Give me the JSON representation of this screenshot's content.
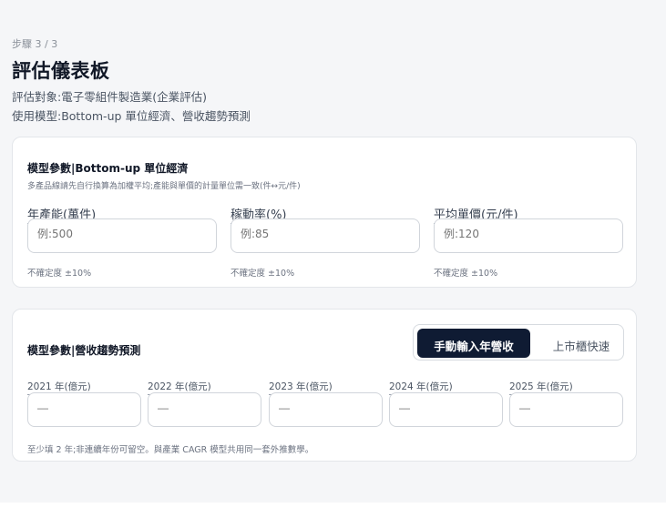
{
  "header": {
    "step": "步驟 3 / 3",
    "title": "評估儀表板",
    "subject": "評估對象:電子零組件製造業(企業評估)",
    "model": "使用模型:Bottom-up 單位經濟、營收趨勢預測"
  },
  "unit_economics": {
    "title": "模型參數|Bottom-up 單位經濟",
    "note": "多產品線請先自行換算為加權平均;產能與單價的計量單位需一致(件↔元/件)",
    "fields": [
      {
        "label": "年產能(萬件)",
        "placeholder": "例:500",
        "hint": "不確定度 ±10%"
      },
      {
        "label": "稼動率(%)",
        "placeholder": "例:85",
        "hint": "不確定度 ±10%"
      },
      {
        "label": "平均單價(元/件)",
        "placeholder": "例:120",
        "hint": "不確定度 ±10%"
      }
    ]
  },
  "revenue_trend": {
    "title": "模型參數|營收趨勢預測",
    "toggle": {
      "active": "手動輸入年營收",
      "inactive": "上市櫃快速"
    },
    "years": [
      {
        "label": "2021 年(億元)",
        "placeholder": "—"
      },
      {
        "label": "2022 年(億元)",
        "placeholder": "—"
      },
      {
        "label": "2023 年(億元)",
        "placeholder": "—"
      },
      {
        "label": "2024 年(億元)",
        "placeholder": "—"
      },
      {
        "label": "2025 年(億元)",
        "placeholder": "—"
      }
    ],
    "footnote": "至少填 2 年;非連續年份可留空。與產業 CAGR 模型共用同一套外推數學。"
  }
}
